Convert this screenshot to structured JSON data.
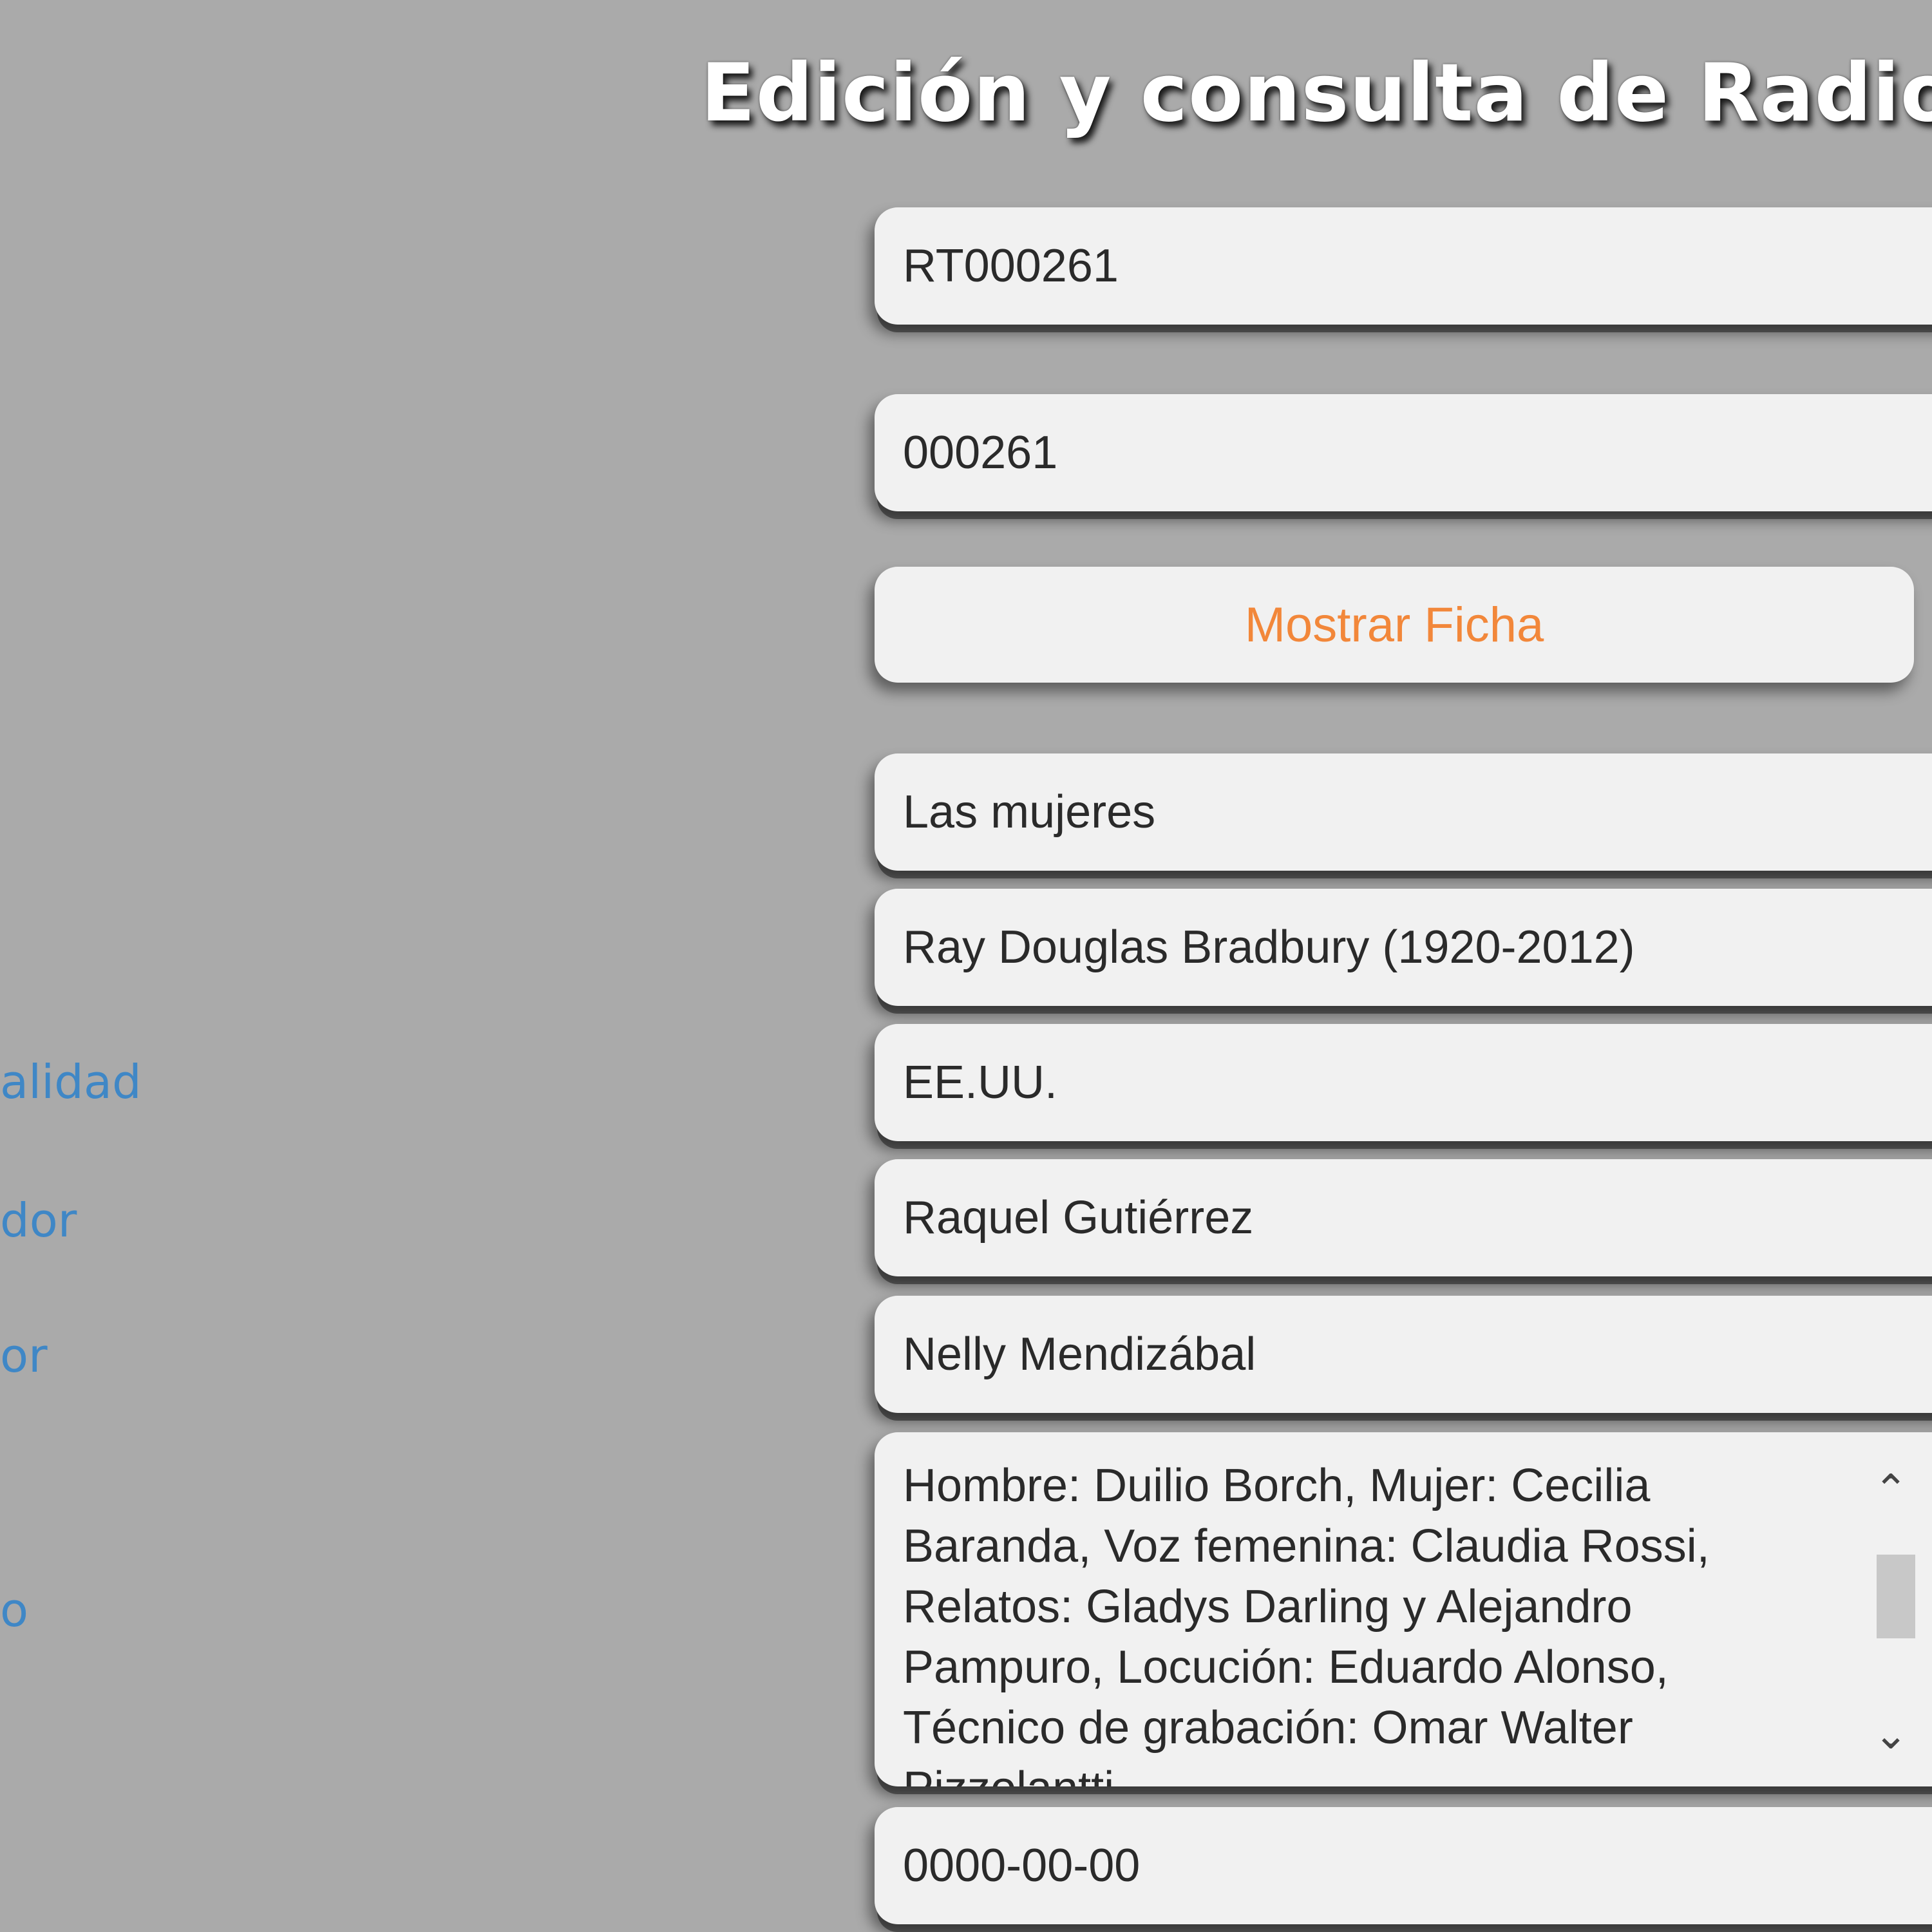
{
  "header": {
    "title": "Edición y consulta de Radiote"
  },
  "labels": [
    {
      "text": "alidad"
    },
    {
      "text": "dor"
    },
    {
      "text": "or"
    },
    {
      "text": "o"
    }
  ],
  "fields": {
    "codigo": "RT000261",
    "numero": "000261",
    "mostrar_ficha": "Mostrar Ficha",
    "titulo": "Las mujeres",
    "autor": "Ray Douglas Bradbury (1920-2012)",
    "nacionalidad": "EE.UU.",
    "adaptador": "Raquel Gutiérrez",
    "director": "Nelly Mendizábal",
    "reparto": "Hombre: Duilio Borch, Mujer: Cecilia Baranda, Voz femenina: Claudia Rossi, Relatos: Gladys Darling y Alejandro Pampuro, Locución: Eduardo Alonso, Técnico de grabación: Omar Walter Pizzolantti",
    "fecha": "0000-00-00"
  }
}
